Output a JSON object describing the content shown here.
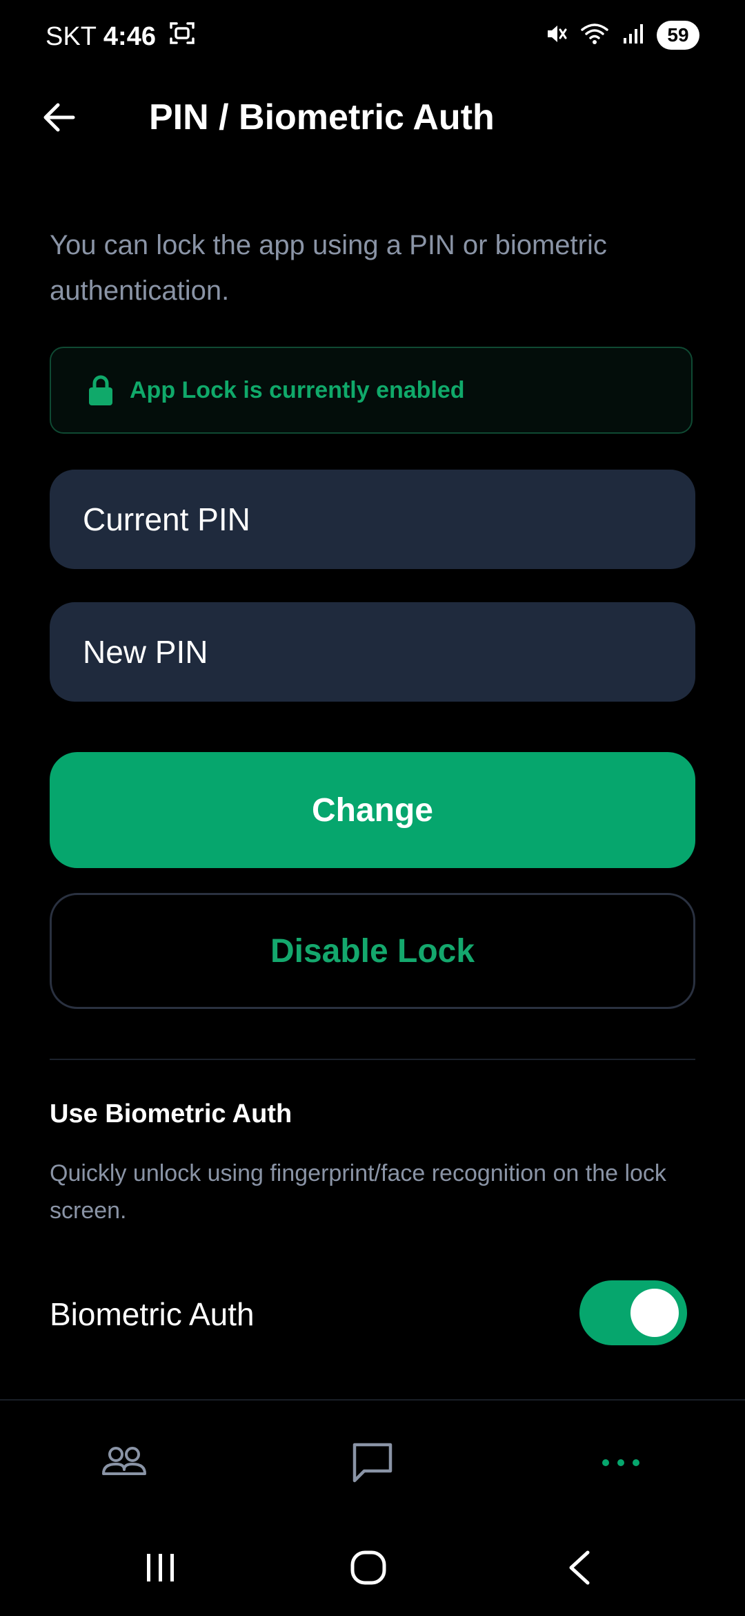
{
  "status_bar": {
    "carrier": "SKT",
    "time": "4:46",
    "battery": "59"
  },
  "header": {
    "title": "PIN / Biometric Auth"
  },
  "description": "You can lock the app using a PIN or biometric authentication.",
  "lock_status": {
    "text": "App Lock is currently enabled"
  },
  "form": {
    "current_pin_placeholder": "Current PIN",
    "new_pin_placeholder": "New PIN",
    "change_label": "Change",
    "disable_label": "Disable Lock"
  },
  "biometric": {
    "section_title": "Use Biometric Auth",
    "section_description": "Quickly unlock using fingerprint/face recognition on the lock screen.",
    "toggle_label": "Biometric Auth",
    "enabled": true
  },
  "colors": {
    "accent": "#06a66d",
    "field_bg": "#1f2a3d",
    "muted_text": "#8a94a6"
  },
  "icons": {
    "back": "arrow-left-icon",
    "lock": "lock-icon",
    "friends": "people-icon",
    "chat": "chat-bubble-icon",
    "more": "more-dots-icon"
  }
}
